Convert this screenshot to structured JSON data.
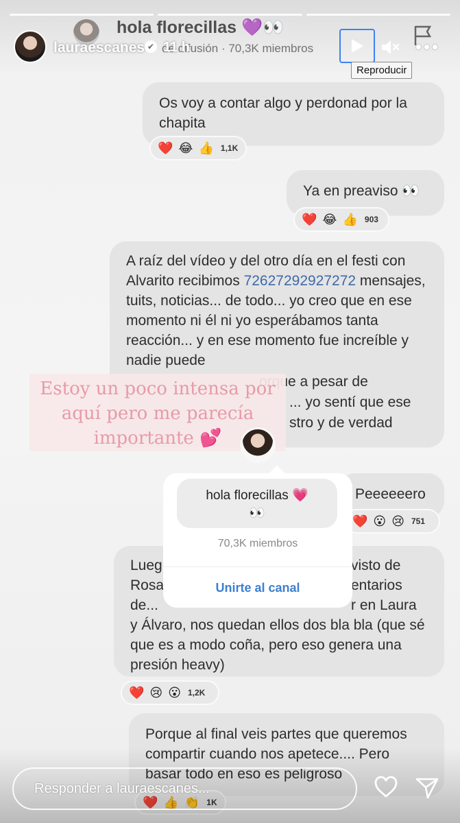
{
  "story": {
    "username": "lauraescanes",
    "time": "11 h",
    "progress_segments": 3
  },
  "background_header": {
    "channel_title": "hola florecillas 💜👀",
    "channel_sub": "de difusión · 70,3K miembros"
  },
  "controls": {
    "tooltip": "Reproducir",
    "play_icon": "play-icon",
    "mute_icon": "muted-speaker-icon",
    "more_icon": "more-dots-icon"
  },
  "messages": [
    {
      "text": "Os voy a contar algo y perdonad por la chapita",
      "reactions": [
        "❤️",
        "😂",
        "👍"
      ],
      "count": "1,1K"
    },
    {
      "text": "Ya en preaviso 👀",
      "reactions": [
        "❤️",
        "😂",
        "👍"
      ],
      "count": "903"
    },
    {
      "text_before": "A raíz del vídeo y del otro día en el festi con Alvarito recibimos ",
      "link": "72627292927272",
      "text_after": " mensajes, tuits, noticias... de todo... yo creo que en ese momento ni él ni yo esperábamos tanta reacción... y en ese momento fue increíble y nadie puede",
      "line8": "orque a pesar de",
      "line9": "... yo sentí que ese",
      "line10": "stro y de verdad"
    },
    {
      "text": "Peeeeeero",
      "reactions": [
        "❤️",
        "😮",
        "😢"
      ],
      "count": "751"
    },
    {
      "line1a": "Lueg",
      "line1b": "visto de",
      "line2a": "Rosa",
      "line2b": "entarios",
      "line3a": "de...",
      "line3b": "r en Laura",
      "line4": "y Álvaro, nos quedan ellos dos bla bla (que sé que es a modo coña, pero eso genera una presión heavy)",
      "reactions": [
        "❤️",
        "😢",
        "😮"
      ],
      "count": "1,2K"
    },
    {
      "text": "Porque al final veis partes que queremos compartir cuando nos apetece.... Pero basar todo en eso es peligroso",
      "reactions": [
        "❤️",
        "👍",
        "👏"
      ],
      "count": "1K"
    }
  ],
  "sticker": {
    "text": "Estoy un poco intensa por aquí pero me parecía importante 💕"
  },
  "channel_card": {
    "title": "hola florecillas 💗",
    "eyes": "👀",
    "members": "70,3K miembros",
    "join_label": "Unirte al canal"
  },
  "reply": {
    "placeholder": "Responder a lauraescanes..."
  },
  "colors": {
    "accent_blue": "#3c7fd1",
    "link_blue": "#3f6aa8",
    "sticker_pink": "#e79aa8",
    "focus_outline": "#3b82f6"
  }
}
